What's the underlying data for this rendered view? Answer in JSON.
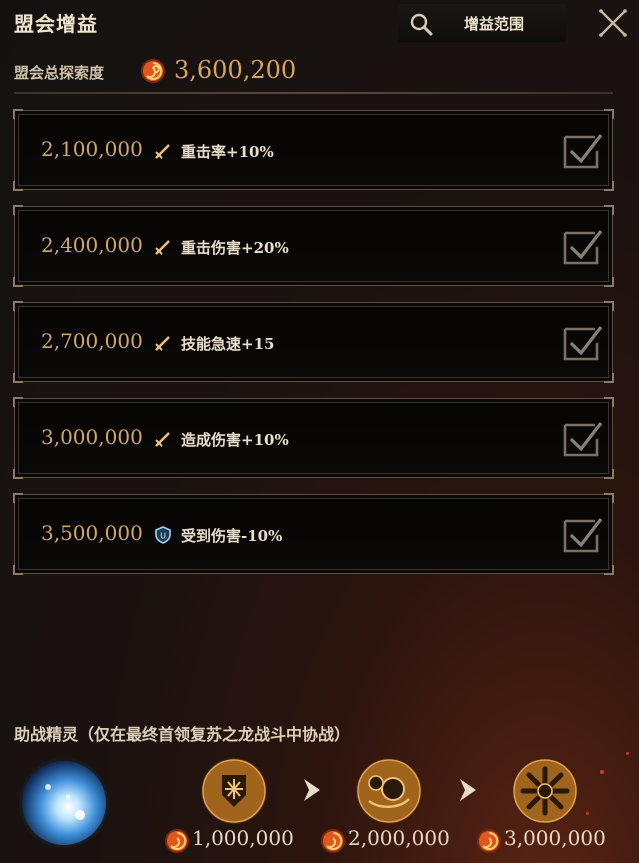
{
  "header": {
    "title": "盟会增益",
    "scope_button_label": "增益范围"
  },
  "total": {
    "label": "盟会总探索度",
    "value": "3,600,200"
  },
  "tiers": [
    {
      "threshold": "2,100,000",
      "buff": "重击率+10%",
      "icon": "sword-icon",
      "achieved": true
    },
    {
      "threshold": "2,400,000",
      "buff": "重击伤害+20%",
      "icon": "sword-icon",
      "achieved": true
    },
    {
      "threshold": "2,700,000",
      "buff": "技能急速+15",
      "icon": "sword-icon",
      "achieved": true
    },
    {
      "threshold": "3,000,000",
      "buff": "造成伤害+10%",
      "icon": "sword-icon",
      "achieved": true
    },
    {
      "threshold": "3,500,000",
      "buff": "受到伤害-10%",
      "icon": "shield-icon",
      "achieved": true
    }
  ],
  "sprite": {
    "title": "助战精灵（仅在最终首领复苏之龙战斗中协战）",
    "stages": [
      {
        "cost": "1,000,000",
        "icon": "frost-emblem-icon"
      },
      {
        "cost": "2,000,000",
        "icon": "swirl-emblem-icon"
      },
      {
        "cost": "3,000,000",
        "icon": "snowflake-emblem-icon"
      }
    ]
  },
  "colors": {
    "gold": "#d4a55c",
    "text": "#e9dec9",
    "panel_border": "#5a5046",
    "coin_orange": "#e0561e",
    "ice_blue": "#4aa6e8"
  }
}
